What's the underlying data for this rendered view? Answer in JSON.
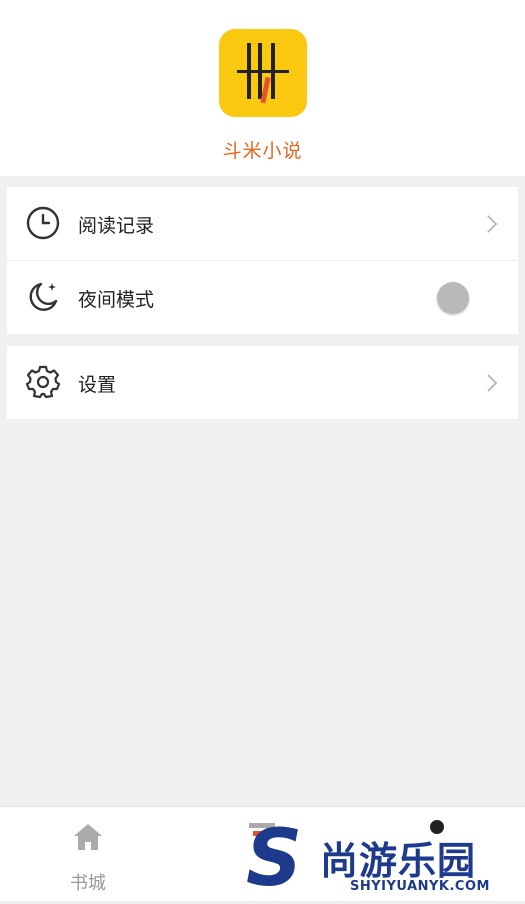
{
  "app": {
    "name": "斗米小说",
    "logo_color": "#f9c80f",
    "name_color": "#e8671c",
    "logo_icon": "bookshelf-logo"
  },
  "menu": {
    "card1": [
      {
        "label": "阅读记录",
        "icon": "clock-icon",
        "action": "chevron-right"
      },
      {
        "label": "夜间模式",
        "icon": "moon-icon",
        "action": "toggle",
        "toggle_on": false
      }
    ],
    "card2": [
      {
        "label": "设置",
        "icon": "gear-icon",
        "action": "chevron-right"
      }
    ]
  },
  "tabbar": {
    "tabs": [
      {
        "label": "书城",
        "icon": "home-icon"
      },
      {
        "label": "",
        "icon": "bookshelf-icon"
      },
      {
        "label": "",
        "icon": "user-icon"
      }
    ]
  },
  "watermark": {
    "text": "尚游乐园",
    "sub": "SHYIYUANYK.COM",
    "letter": "S"
  }
}
